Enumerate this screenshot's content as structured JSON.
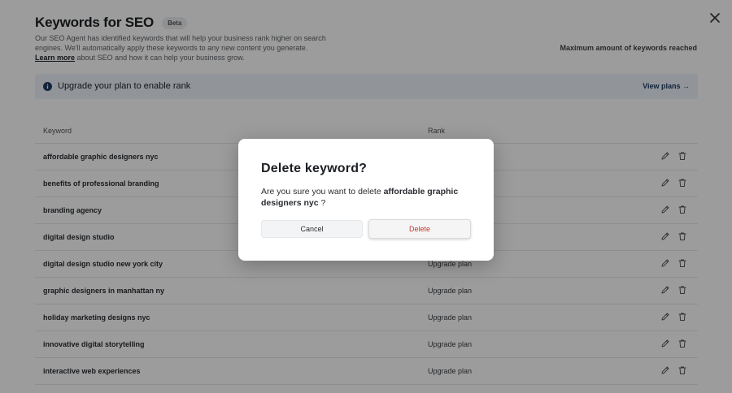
{
  "header": {
    "title": "Keywords for SEO",
    "badge": "Beta",
    "description_1": "Our SEO Agent has identified keywords that will help your business rank higher on search engines. We'll automatically apply these keywords to any new content you generate.",
    "learn_more": "Learn more",
    "description_2": "about SEO and how it can help your business grow.",
    "max_reached": "Maximum amount of keywords reached"
  },
  "banner": {
    "text": "Upgrade your plan to enable rank",
    "link": "View plans →"
  },
  "table": {
    "headers": {
      "keyword": "Keyword",
      "rank": "Rank"
    },
    "rows": [
      {
        "keyword": "affordable graphic designers nyc",
        "rank": ""
      },
      {
        "keyword": "benefits of professional branding",
        "rank": ""
      },
      {
        "keyword": "branding agency",
        "rank": ""
      },
      {
        "keyword": "digital design studio",
        "rank": ""
      },
      {
        "keyword": "digital design studio new york city",
        "rank": "Upgrade plan"
      },
      {
        "keyword": "graphic designers in manhattan ny",
        "rank": "Upgrade plan"
      },
      {
        "keyword": "holiday marketing designs nyc",
        "rank": "Upgrade plan"
      },
      {
        "keyword": "innovative digital storytelling",
        "rank": "Upgrade plan"
      },
      {
        "keyword": "interactive web experiences",
        "rank": "Upgrade plan"
      }
    ]
  },
  "modal": {
    "title": "Delete keyword?",
    "text_prefix": "Are you sure you want to delete ",
    "keyword": "affordable graphic designers nyc",
    "text_suffix": " ?",
    "cancel": "Cancel",
    "delete": "Delete"
  },
  "icons": {
    "close": "close-icon",
    "info": "info-icon",
    "edit": "pencil-icon",
    "delete": "trash-icon"
  },
  "colors": {
    "banner_bg": "#eef4fb",
    "link": "#1f3b63",
    "danger": "#c0392b",
    "info_icon": "#1f3b63"
  }
}
